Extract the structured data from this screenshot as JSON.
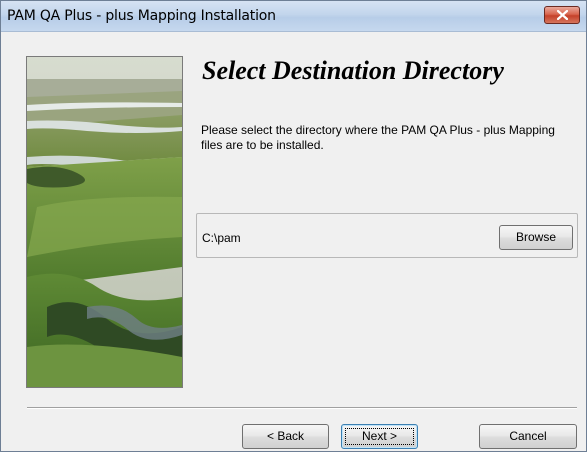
{
  "window": {
    "title": "PAM QA Plus - plus Mapping Installation"
  },
  "main": {
    "heading": "Select Destination Directory",
    "instructions": "Please select the directory where the PAM QA Plus - plus Mapping files are to be installed."
  },
  "destination": {
    "path": "C:\\pam",
    "browse_label": "Browse"
  },
  "footer": {
    "back_label": "< Back",
    "next_label": "Next >",
    "cancel_label": "Cancel"
  },
  "icons": {
    "close": "close-icon"
  },
  "colors": {
    "close_button": "#c5412a",
    "titlebar": "#c2d5ec",
    "dialog_background": "#f0f0f0"
  }
}
